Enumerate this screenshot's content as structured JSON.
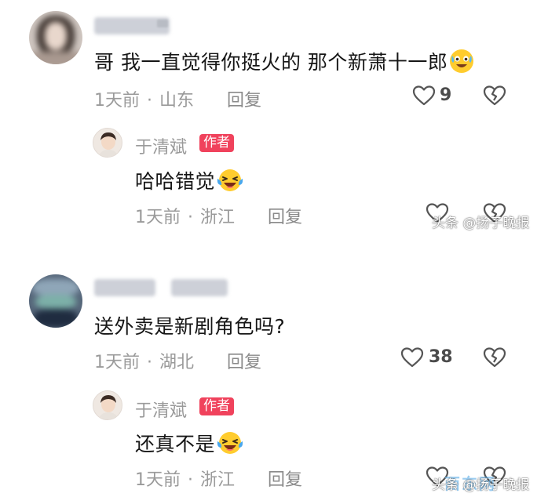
{
  "comments": [
    {
      "text": "哥 我一直觉得你挺火的 那个新萧十一郎",
      "time": "1天前",
      "location": "山东",
      "reply_label": "回复",
      "likes": "9",
      "reply": {
        "author": "于清斌",
        "author_tag": "作者",
        "text": "哈哈错觉",
        "time": "1天前",
        "location": "浙江",
        "reply_label": "回复"
      }
    },
    {
      "text": "送外卖是新剧角色吗?",
      "time": "1天前",
      "location": "湖北",
      "reply_label": "回复",
      "likes": "38",
      "reply": {
        "author": "于清斌",
        "author_tag": "作者",
        "text": "还真不是",
        "time": "1天前",
        "location": "浙江",
        "reply_label": "回复"
      }
    }
  ],
  "watermark": "头条 @扬子晚报",
  "site_stamp": "西东网",
  "dot_separator": "·",
  "colors": {
    "author_tag_bg": "#f0425c",
    "meta_text": "#9a9a9a"
  },
  "icons": [
    "heart-outline-icon",
    "broken-heart-icon",
    "grinning-sweat-emoji",
    "laughing-tears-emoji"
  ]
}
